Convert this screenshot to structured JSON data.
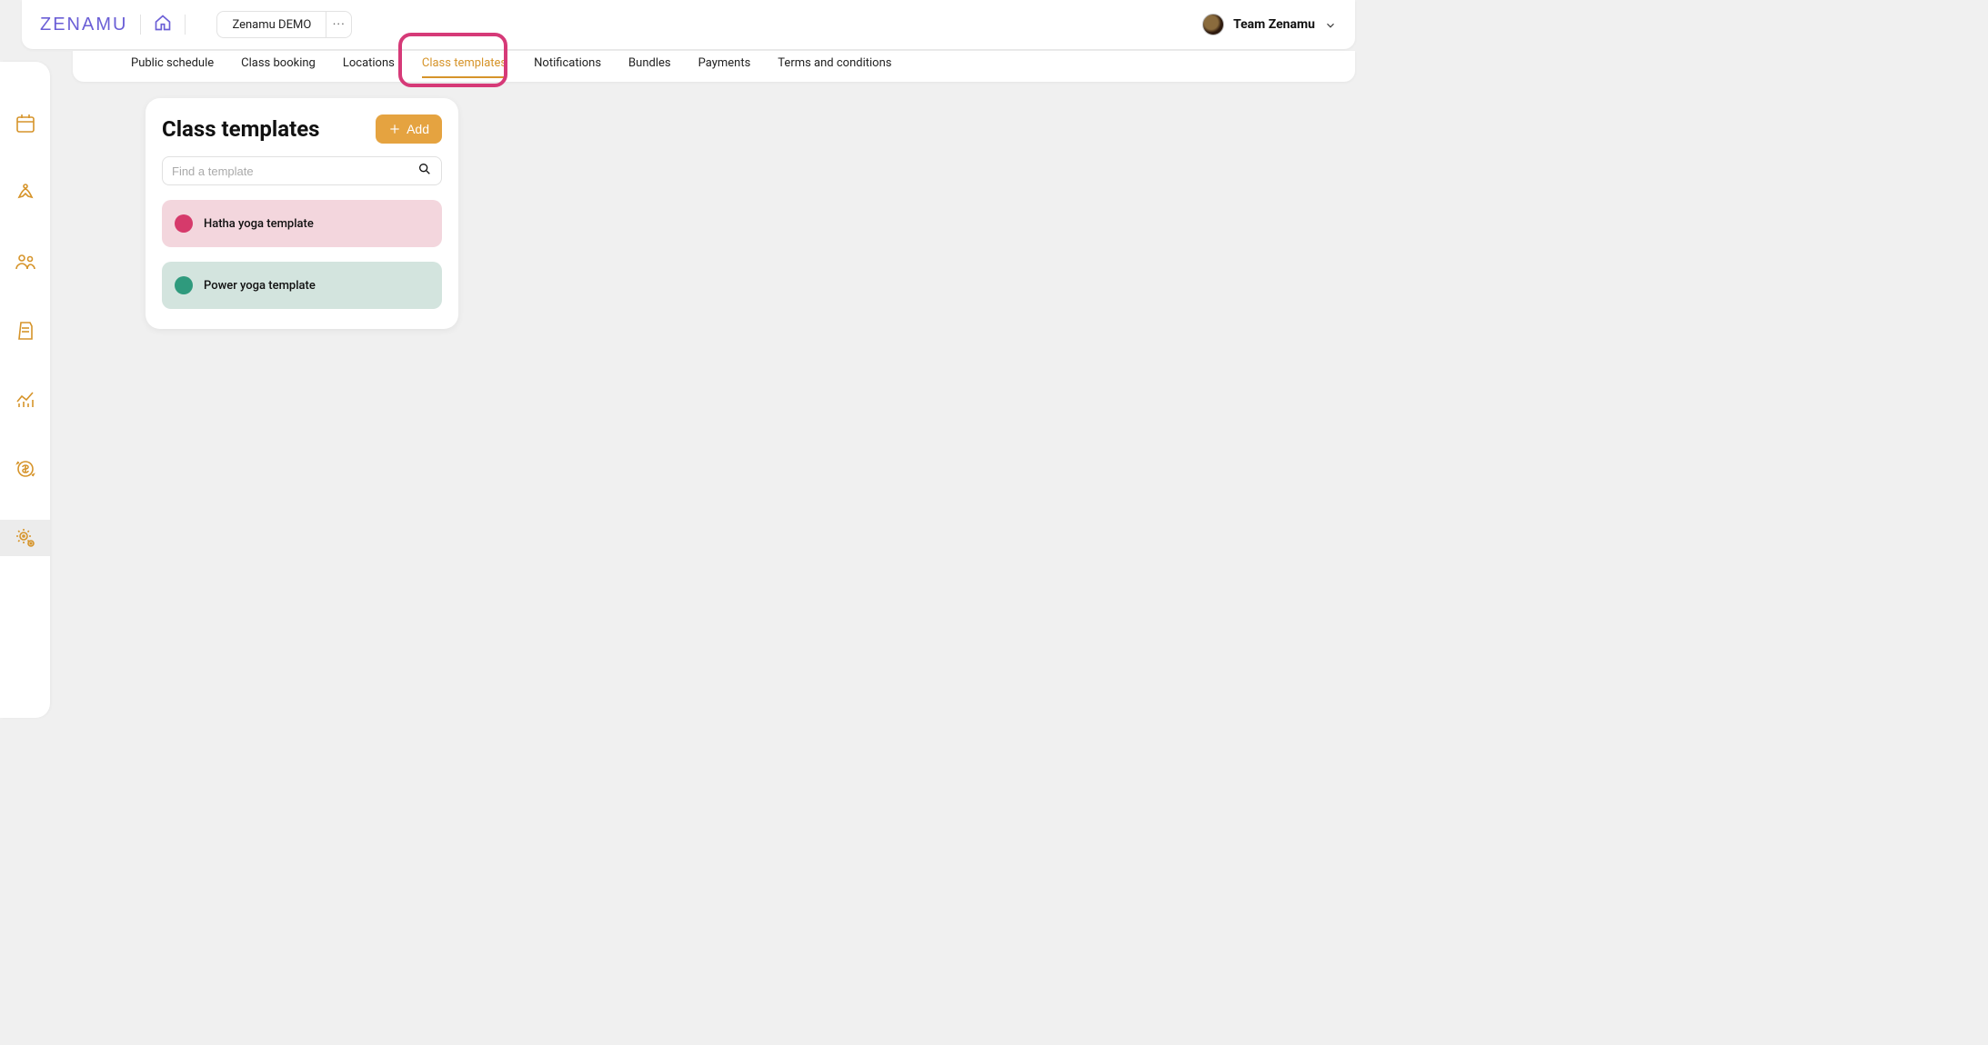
{
  "header": {
    "logo": "ZENAMU",
    "demo_label": "Zenamu DEMO",
    "user_name": "Team Zenamu"
  },
  "sidebar": {
    "items": [
      {
        "name": "calendar-icon"
      },
      {
        "name": "meditation-icon"
      },
      {
        "name": "people-icon"
      },
      {
        "name": "document-icon"
      },
      {
        "name": "analytics-icon"
      },
      {
        "name": "money-icon"
      },
      {
        "name": "settings-icon",
        "active": true
      }
    ]
  },
  "tabs": [
    {
      "label": "Public schedule",
      "active": false
    },
    {
      "label": "Class booking",
      "active": false
    },
    {
      "label": "Locations",
      "active": false
    },
    {
      "label": "Class templates",
      "active": true
    },
    {
      "label": "Notifications",
      "active": false
    },
    {
      "label": "Bundles",
      "active": false
    },
    {
      "label": "Payments",
      "active": false
    },
    {
      "label": "Terms and conditions",
      "active": false
    }
  ],
  "panel": {
    "title": "Class templates",
    "add_label": "Add",
    "search_placeholder": "Find a template",
    "templates": [
      {
        "name": "Hatha yoga template",
        "bg": "#f3d6dd",
        "dot": "#d63a6b"
      },
      {
        "name": "Power yoga template",
        "bg": "#d3e4de",
        "dot": "#2f9a7d"
      }
    ]
  }
}
